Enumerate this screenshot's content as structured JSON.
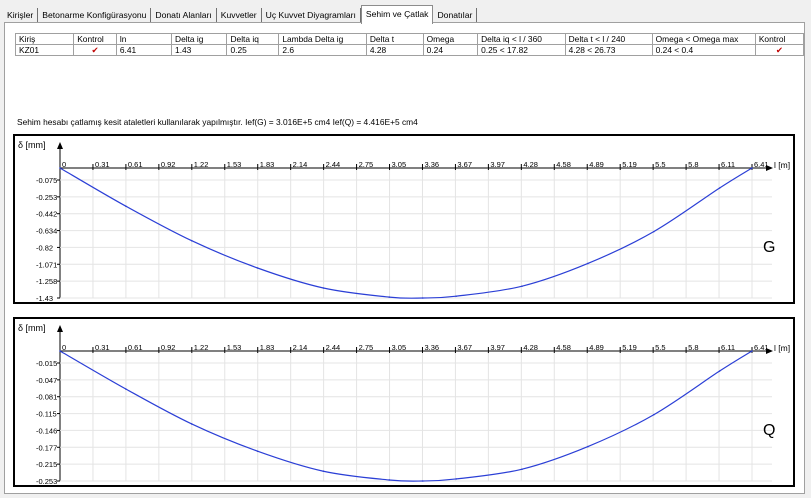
{
  "tabs": [
    {
      "label": "Kirişler",
      "active": false
    },
    {
      "label": "Betonarme Konfigürasyonu",
      "active": false
    },
    {
      "label": "Donatı Alanları",
      "active": false
    },
    {
      "label": "Kuvvetler",
      "active": false
    },
    {
      "label": "Uç Kuvvet Diyagramları",
      "active": false
    },
    {
      "label": "Sehim ve Çatlak",
      "active": true
    },
    {
      "label": "Donatılar",
      "active": false
    }
  ],
  "table": {
    "columns": [
      "Kiriş",
      "Kontrol",
      "ln",
      "Delta ig",
      "Delta iq",
      "Lambda Delta ig",
      "Delta t",
      "Omega",
      "Delta iq < l / 360",
      "Delta t < l / 240",
      "Omega < Omega max",
      "Kontrol"
    ],
    "rows": [
      [
        "KZ01",
        "✔",
        "6.41",
        "1.43",
        "0.25",
        "2.6",
        "4.28",
        "0.24",
        "0.25 < 17.82",
        "4.28 < 26.73",
        "0.24 < 0.4",
        "✔"
      ]
    ]
  },
  "note": "Sehim hesabı çatlamış kesit ataletleri kullanılarak yapılmıştır. Ief(G) = 3.016E+5 cm4 Ief(Q) = 4.416E+5 cm4",
  "colors": {
    "curve": "#2b3fd6",
    "check": "#c00000"
  },
  "chart_data": [
    {
      "type": "line",
      "title": "G",
      "ylabel": "δ [mm]",
      "xlabel": "l [m]",
      "x_ticks": [
        "0",
        "0.31",
        "0.61",
        "0.92",
        "1.22",
        "1.53",
        "1.83",
        "2.14",
        "2.44",
        "2.75",
        "3.05",
        "3.36",
        "3.67",
        "3.97",
        "4.28",
        "4.58",
        "4.89",
        "5.19",
        "5.5",
        "5.8",
        "6.11",
        "6.41"
      ],
      "y_ticks": [
        "-0.075",
        "-0.253",
        "-0.442",
        "-0.634",
        "-0.82",
        "-1.071",
        "-1.258",
        "-1.43"
      ],
      "xlim": [
        0,
        6.41
      ],
      "ylim": [
        -1.43,
        0
      ],
      "grid": true,
      "series": [
        {
          "x": [
            0,
            0.61,
            1.22,
            1.83,
            2.44,
            3.05,
            3.36,
            3.67,
            4.28,
            4.89,
            5.5,
            6.11,
            6.41
          ],
          "y": [
            0,
            -0.42,
            -0.8,
            -1.1,
            -1.32,
            -1.42,
            -1.43,
            -1.41,
            -1.3,
            -1.05,
            -0.7,
            -0.22,
            0
          ]
        }
      ]
    },
    {
      "type": "line",
      "title": "Q",
      "ylabel": "δ [mm]",
      "xlabel": "l [m]",
      "x_ticks": [
        "0",
        "0.31",
        "0.61",
        "0.92",
        "1.22",
        "1.53",
        "1.83",
        "2.14",
        "2.44",
        "2.75",
        "3.05",
        "3.36",
        "3.67",
        "3.97",
        "4.28",
        "4.58",
        "4.89",
        "5.19",
        "5.5",
        "5.8",
        "6.11",
        "6.41"
      ],
      "y_ticks": [
        "-0.015",
        "-0.047",
        "-0.081",
        "-0.115",
        "-0.146",
        "-0.177",
        "-0.215",
        "-0.253"
      ],
      "xlim": [
        0,
        6.41
      ],
      "ylim": [
        -0.253,
        0
      ],
      "grid": true,
      "series": [
        {
          "x": [
            0,
            0.61,
            1.22,
            1.83,
            2.44,
            3.05,
            3.36,
            3.67,
            4.28,
            4.89,
            5.5,
            6.11,
            6.41
          ],
          "y": [
            0,
            -0.074,
            -0.142,
            -0.195,
            -0.234,
            -0.251,
            -0.253,
            -0.249,
            -0.23,
            -0.186,
            -0.124,
            -0.039,
            0
          ]
        }
      ]
    }
  ]
}
